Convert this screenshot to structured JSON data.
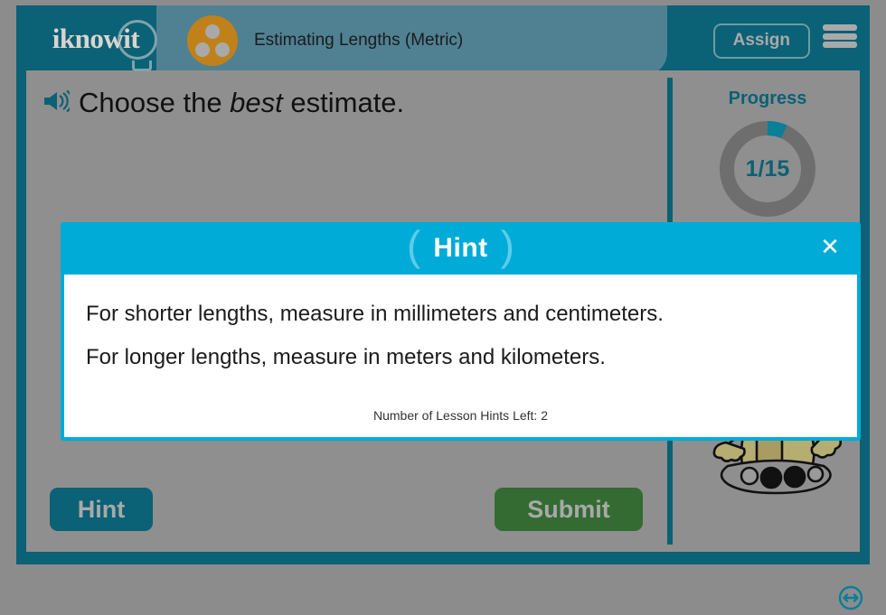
{
  "header": {
    "logo_text": "iknowit",
    "logo_bulb_icon": "lightbulb-icon",
    "subject_badge_icon": "three-dots-badge-icon",
    "lesson_title": "Estimating Lengths (Metric)",
    "assign_label": "Assign",
    "menu_icon": "hamburger-menu-icon"
  },
  "main": {
    "speaker_icon": "speaker-sound-icon",
    "question_prefix": "Choose the ",
    "question_emphasis": "best",
    "question_suffix": " estimate.",
    "question_full": "Choose the best estimate.",
    "progress_label": "Progress",
    "progress_count": "1/15",
    "progress_current": 1,
    "progress_total": 15,
    "mascot_icon": "robot-mascot-icon",
    "resize_icon": "resize-horizontal-icon"
  },
  "footer": {
    "hint_label": "Hint",
    "submit_label": "Submit"
  },
  "dialog": {
    "title": "Hint",
    "paren_left": "(",
    "paren_right": ")",
    "close_icon": "close-x-icon",
    "close_label": "✕",
    "lines": [
      "For shorter lengths, measure in millimeters and centimeters.",
      "For longer lengths, measure in meters and kilometers."
    ],
    "hints_left_text": "Number of Lesson Hints Left: 2"
  },
  "colors": {
    "frame_teal": "#0b6175",
    "panel_gray": "#8f8f8f",
    "dialog_cyan": "#00abd8",
    "badge_orange": "#c0811a",
    "submit_green": "#336b33"
  }
}
